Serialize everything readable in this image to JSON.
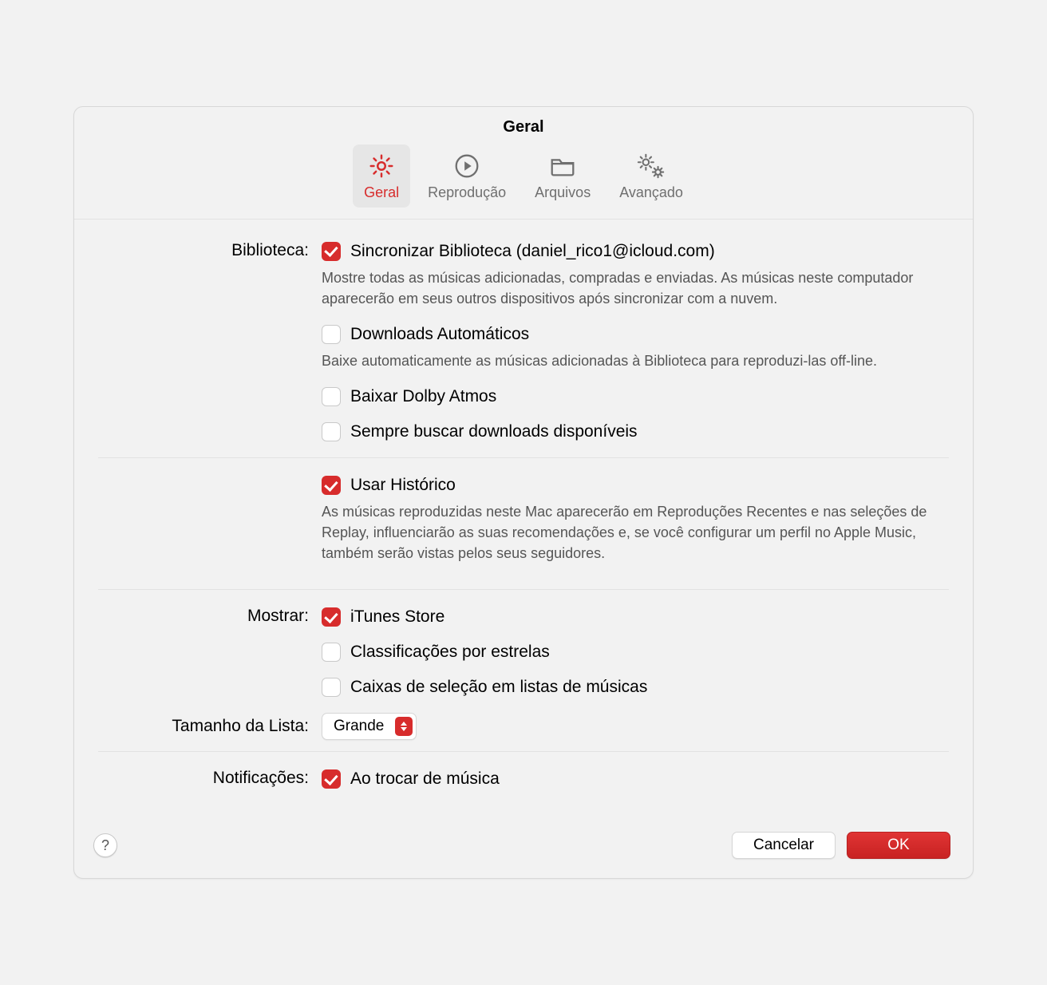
{
  "window": {
    "title": "Geral"
  },
  "tabs": {
    "general": "Geral",
    "playback": "Reprodução",
    "files": "Arquivos",
    "advanced": "Avançado"
  },
  "sections": {
    "library": {
      "label": "Biblioteca:",
      "sync": {
        "label": "Sincronizar Biblioteca (daniel_rico1@icloud.com)",
        "checked": true,
        "desc": "Mostre todas as músicas adicionadas, compradas e enviadas. As músicas neste computador aparecerão em seus outros dispositivos após sincronizar com a nuvem."
      },
      "autoDownload": {
        "label": "Downloads Automáticos",
        "checked": false,
        "desc": "Baixe automaticamente as músicas adicionadas à Biblioteca para reproduzi-las off-line."
      },
      "dolby": {
        "label": "Baixar Dolby Atmos",
        "checked": false
      },
      "alwaysFetch": {
        "label": "Sempre buscar downloads disponíveis",
        "checked": false
      }
    },
    "history": {
      "label": "Usar Histórico",
      "checked": true,
      "desc": "As músicas reproduzidas neste Mac aparecerão em Reproduções Recentes e nas seleções de Replay, influenciarão as suas recomendações e, se você configurar um perfil no Apple Music, também serão vistas pelos seus seguidores."
    },
    "show": {
      "label": "Mostrar:",
      "itunes": {
        "label": "iTunes Store",
        "checked": true
      },
      "stars": {
        "label": "Classificações por estrelas",
        "checked": false
      },
      "checkboxes": {
        "label": "Caixas de seleção em listas de músicas",
        "checked": false
      }
    },
    "listSize": {
      "label": "Tamanho da Lista:",
      "value": "Grande"
    },
    "notifications": {
      "label": "Notificações:",
      "onChange": {
        "label": "Ao trocar de música",
        "checked": true
      }
    }
  },
  "footer": {
    "help": "?",
    "cancel": "Cancelar",
    "ok": "OK"
  },
  "colors": {
    "accent": "#d72c2c"
  }
}
